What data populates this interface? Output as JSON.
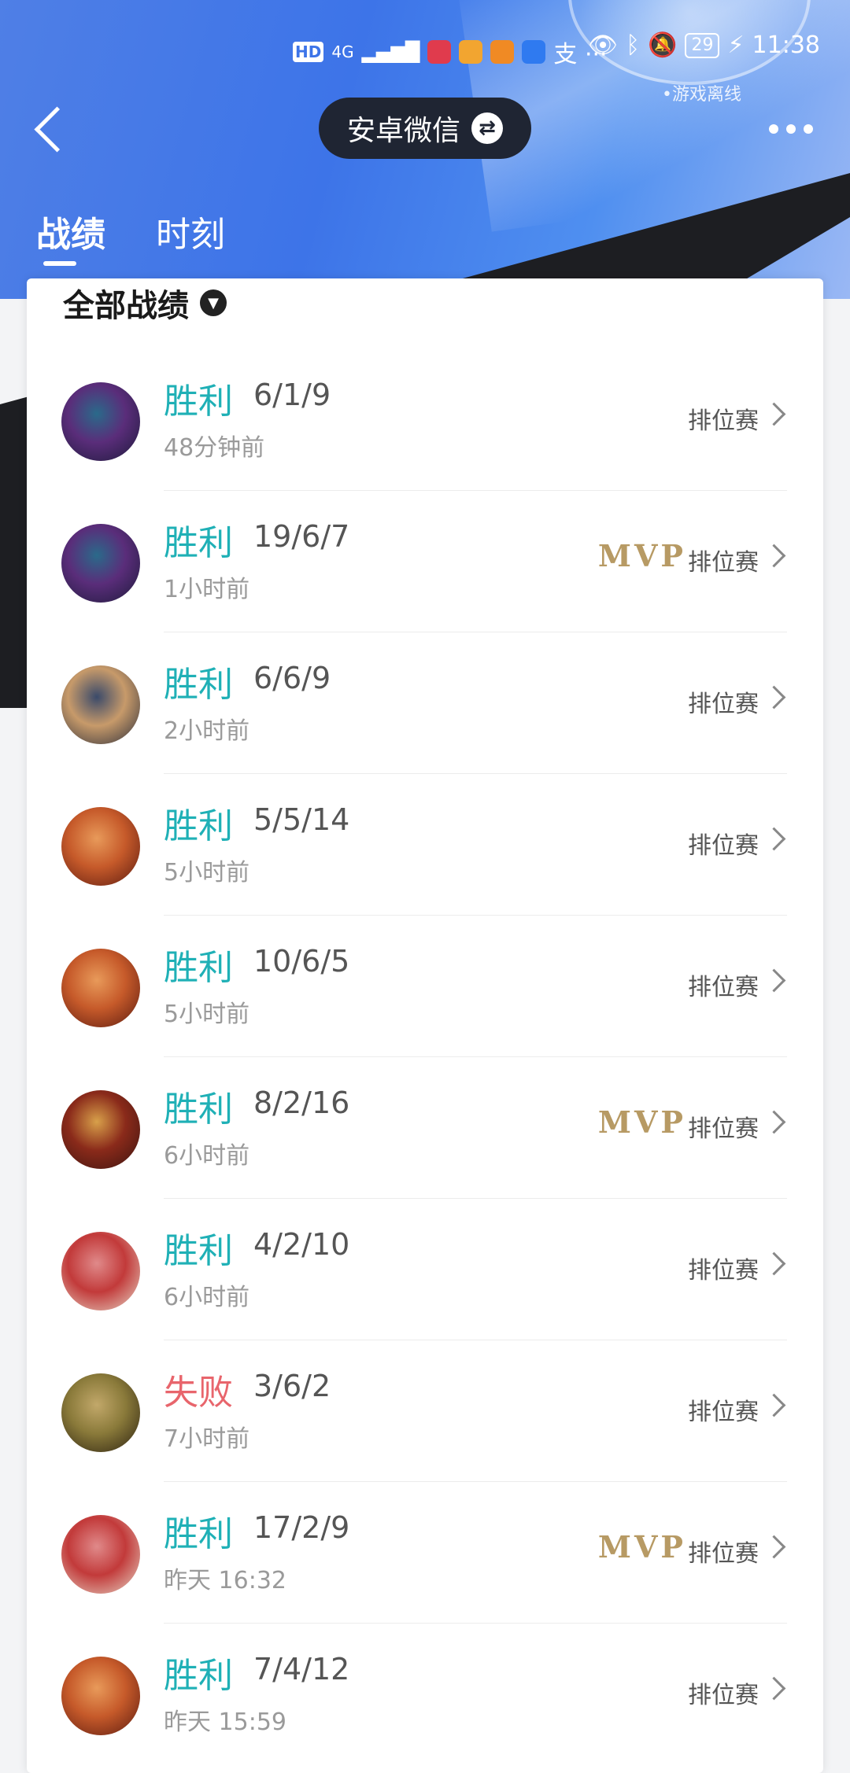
{
  "status_bar": {
    "hd": "HD",
    "signal": "4G",
    "extra": "支 ···",
    "battery": "29",
    "time": "11:38"
  },
  "game_status": "•游戏离线",
  "header": {
    "account": "安卓微信",
    "swap_icon": "swap-icon",
    "more_icon": "more-icon"
  },
  "tabs": [
    {
      "label": "战绩",
      "active": true
    },
    {
      "label": "时刻",
      "active": false
    }
  ],
  "filter": {
    "label": "全部战绩"
  },
  "colors": {
    "win": "#1fb0b6",
    "loss": "#e8656c",
    "mvp": "#b79a64"
  },
  "matches": [
    {
      "result": "胜利",
      "kda": "6/1/9",
      "time": "48分钟前",
      "mode": "排位赛",
      "mvp": "",
      "avatar": [
        "#1c1a3a",
        "#5a2d7a",
        "#2a6a8a"
      ]
    },
    {
      "result": "胜利",
      "kda": "19/6/7",
      "time": "1小时前",
      "mode": "排位赛",
      "mvp": "MVP",
      "avatar": [
        "#1c1a3a",
        "#5a2d7a",
        "#2a6a8a"
      ]
    },
    {
      "result": "胜利",
      "kda": "6/6/9",
      "time": "2小时前",
      "mode": "排位赛",
      "mvp": "",
      "avatar": [
        "#2a2d3a",
        "#c79a6a",
        "#3a4a6a"
      ]
    },
    {
      "result": "胜利",
      "kda": "5/5/14",
      "time": "5小时前",
      "mode": "排位赛",
      "mvp": "",
      "avatar": [
        "#5a1a10",
        "#c65a2a",
        "#e89a5a"
      ]
    },
    {
      "result": "胜利",
      "kda": "10/6/5",
      "time": "5小时前",
      "mode": "排位赛",
      "mvp": "",
      "avatar": [
        "#5a1a10",
        "#c65a2a",
        "#e89a5a"
      ]
    },
    {
      "result": "胜利",
      "kda": "8/2/16",
      "time": "6小时前",
      "mode": "排位赛",
      "mvp": "MVP",
      "avatar": [
        "#3a1410",
        "#8a2a1a",
        "#d8a04a"
      ]
    },
    {
      "result": "胜利",
      "kda": "4/2/10",
      "time": "6小时前",
      "mode": "排位赛",
      "mvp": "",
      "avatar": [
        "#e6d8c8",
        "#c23a3a",
        "#e08a8a"
      ]
    },
    {
      "result": "失败",
      "kda": "3/6/2",
      "time": "7小时前",
      "mode": "排位赛",
      "mvp": "",
      "avatar": [
        "#2a2010",
        "#8a7a3a",
        "#c2a86a"
      ]
    },
    {
      "result": "胜利",
      "kda": "17/2/9",
      "time": "昨天 16:32",
      "mode": "排位赛",
      "mvp": "MVP",
      "avatar": [
        "#e6d8c8",
        "#c23a3a",
        "#e08a8a"
      ]
    },
    {
      "result": "胜利",
      "kda": "7/4/12",
      "time": "昨天 15:59",
      "mode": "排位赛",
      "mvp": "",
      "avatar": [
        "#5a1a10",
        "#c65a2a",
        "#e89a5a"
      ]
    }
  ]
}
